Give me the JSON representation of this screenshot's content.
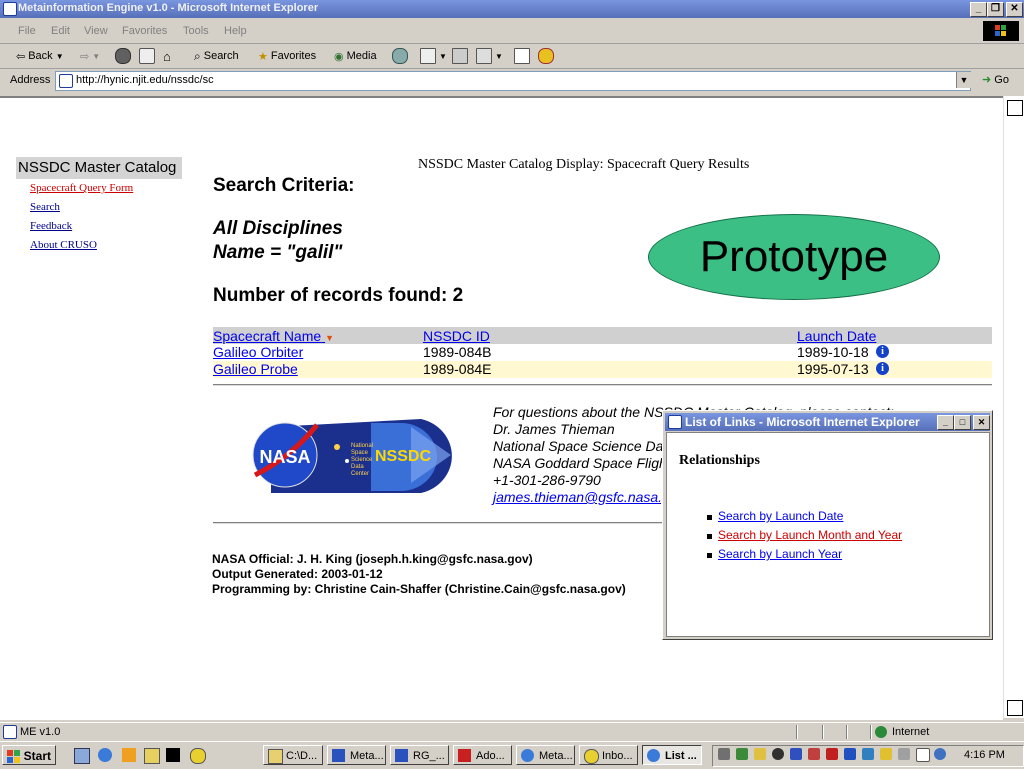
{
  "window": {
    "title": "Metainformation Engine v1.0 - Microsoft Internet Explorer",
    "controls": [
      "_",
      "❐",
      "✕"
    ]
  },
  "menu": [
    "File",
    "Edit",
    "View",
    "Favorites",
    "Tools",
    "Help"
  ],
  "toolbar": {
    "back": "Back",
    "search": "Search",
    "favorites": "Favorites",
    "media": "Media"
  },
  "address": {
    "label": "Address",
    "url": "http://hynic.njit.edu/nssdc/sc",
    "go": "Go"
  },
  "sidebar": {
    "title": "NSSDC Master Catalog",
    "links": [
      "Spacecraft Query Form",
      "Search",
      "Feedback",
      "About CRUSO"
    ]
  },
  "page": {
    "heading": "NSSDC Master Catalog Display: Spacecraft Query Results",
    "criteria_label": "Search Criteria:",
    "discipline": "All Disciplines",
    "name_filter": "Name = \"galil\"",
    "records_found": "Number of records found: 2",
    "prototype": "Prototype"
  },
  "table": {
    "headers": [
      "Spacecraft Name",
      "NSSDC ID",
      "Launch Date"
    ],
    "rows": [
      {
        "name": "Galileo Orbiter",
        "id": "1989-084B",
        "date": "1989-10-18"
      },
      {
        "name": "Galileo Probe",
        "id": "1989-084E",
        "date": "1995-07-13"
      }
    ],
    "row_colors": [
      "#ffffff",
      "#fff8d0"
    ]
  },
  "contact": {
    "lines": [
      "For questions about the NSSDC Master Catalog, please contact:",
      "Dr. James Thieman",
      "National Space Science Data Center",
      "NASA Goddard Space Flight Center",
      "+1-301-286-9790"
    ],
    "email": "james.thieman@gsfc.nasa.gov"
  },
  "logo": {
    "nasa": "NASA",
    "nssdc": "NSSDC",
    "caption": [
      "National",
      "Space",
      "Science",
      "Data",
      "Center"
    ]
  },
  "footer": {
    "official": "NASA Official: J. H. King (joseph.h.king@gsfc.nasa.gov)",
    "generated": "Output Generated: 2003-01-12",
    "programming": "Programming by: Christine Cain-Shaffer (Christine.Cain@gsfc.nasa.gov)"
  },
  "popup": {
    "title": "List of Links - Microsoft Internet Explorer",
    "heading": "Relationships",
    "links": [
      {
        "label": "Search by Launch Date",
        "color": "#0000ee"
      },
      {
        "label": "Search by Launch Month and Year",
        "color": "#cc0000"
      },
      {
        "label": "Search by Launch Year",
        "color": "#0000ee"
      }
    ]
  },
  "status": {
    "text": "ME v1.0",
    "zone": "Internet"
  },
  "taskbar": {
    "start": "Start",
    "tasks": [
      {
        "label": "C:\\D...",
        "active": false
      },
      {
        "label": "Meta...",
        "active": false
      },
      {
        "label": "RG_...",
        "active": false
      },
      {
        "label": "Ado...",
        "active": false
      },
      {
        "label": "Meta...",
        "active": false
      },
      {
        "label": "Inbo...",
        "active": false
      },
      {
        "label": "List ...",
        "active": true
      }
    ],
    "clock": "4:16 PM"
  },
  "colors": {
    "titlebar": "#566fb8",
    "prototype": "#3cbf84",
    "link": "#0000ee",
    "sidebar_link": "#00008b"
  }
}
